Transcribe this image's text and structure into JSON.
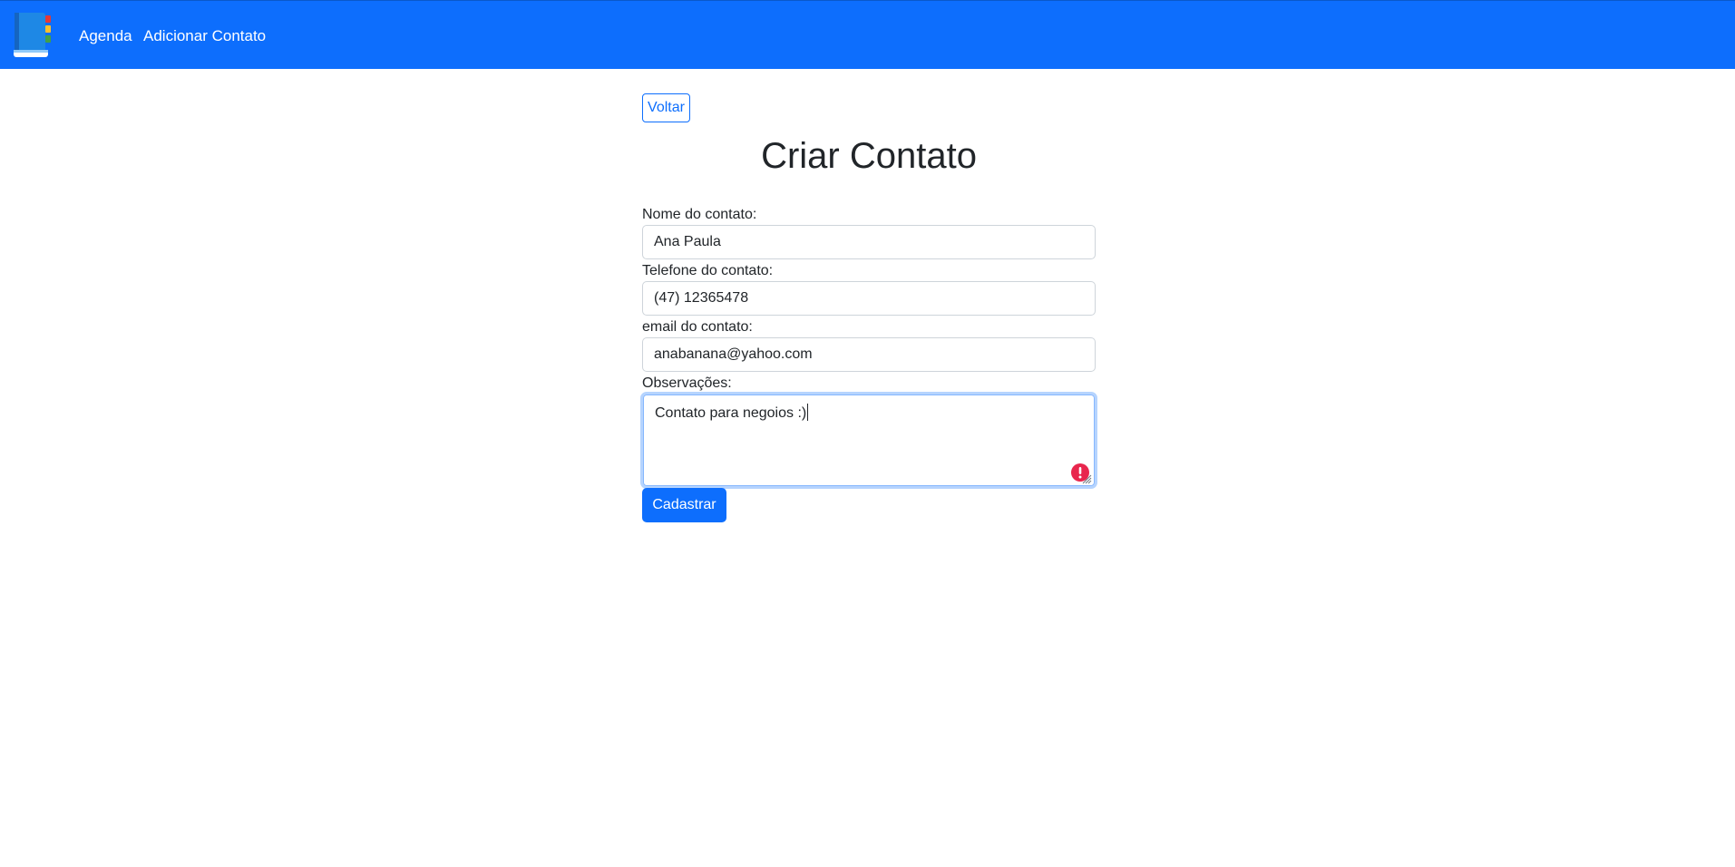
{
  "navbar": {
    "logo_icon": "address-book-icon",
    "links": [
      "Agenda",
      "Adicionar Contato"
    ],
    "background": "#0d6efd"
  },
  "back_button": "Voltar",
  "page_title": "Criar Contato",
  "form": {
    "name_label": "Nome do contato:",
    "name_value": "Ana Paula",
    "phone_label": "Telefone do contato:",
    "phone_value": "(47) 12365478",
    "email_label": "email do contato:",
    "email_value": "anabanana@yahoo.com",
    "notes_label": "Observações:",
    "notes_value": "Contato para negoios :)",
    "warning_icon": "spellcheck-warning-icon",
    "submit_label": "Cadastrar"
  },
  "colors": {
    "primary": "#0d6efd",
    "warning": "#e8264d"
  }
}
